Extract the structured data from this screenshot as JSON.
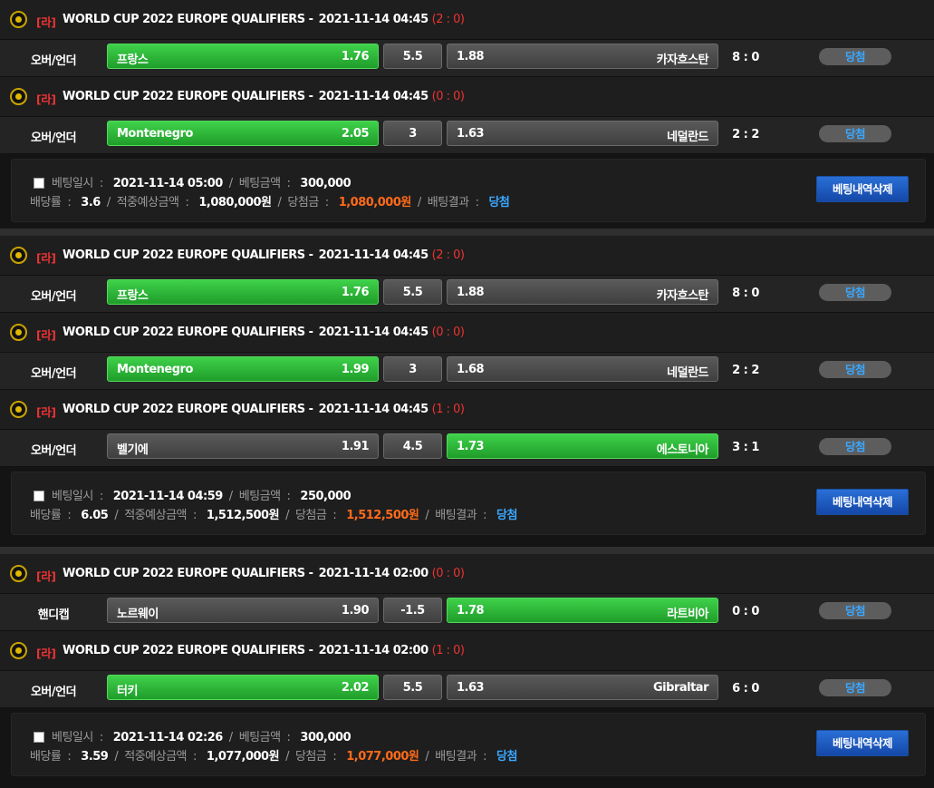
{
  "slips": [
    {
      "matches": [
        {
          "tag": "[라]",
          "league": "WORLD CUP 2022 EUROPE QUALIFIERS -",
          "date": "2021-11-14 04:45",
          "half_score": "(2 : 0)",
          "type": "오버/언더",
          "home": "프랑스",
          "home_odds": "1.76",
          "mid": "5.5",
          "away_odds": "1.88",
          "away": "카자흐스탄",
          "final_score": "8 : 0",
          "result": "당첨",
          "win": "home"
        },
        {
          "tag": "[라]",
          "league": "WORLD CUP 2022 EUROPE QUALIFIERS -",
          "date": "2021-11-14 04:45",
          "half_score": "(0 : 0)",
          "type": "오버/언더",
          "home": "Montenegro",
          "home_odds": "2.05",
          "mid": "3",
          "away_odds": "1.63",
          "away": "네덜란드",
          "final_score": "2 : 2",
          "result": "당첨",
          "win": "home"
        }
      ],
      "summary": {
        "bet_time_label": "베팅일시",
        "bet_time": "2021-11-14 05:00",
        "bet_amount_label": "베팅금액",
        "bet_amount": "300,000",
        "odds_label": "배당률",
        "odds": "3.6",
        "expected_label": "적중예상금액",
        "expected": "1,080,000원",
        "win_amount_label": "당첨금",
        "win_amount": "1,080,000원",
        "result_label": "배팅결과",
        "result": "당첨",
        "delete_label": "베팅내역삭제"
      }
    },
    {
      "matches": [
        {
          "tag": "[라]",
          "league": "WORLD CUP 2022 EUROPE QUALIFIERS -",
          "date": "2021-11-14 04:45",
          "half_score": "(2 : 0)",
          "type": "오버/언더",
          "home": "프랑스",
          "home_odds": "1.76",
          "mid": "5.5",
          "away_odds": "1.88",
          "away": "카자흐스탄",
          "final_score": "8 : 0",
          "result": "당첨",
          "win": "home"
        },
        {
          "tag": "[라]",
          "league": "WORLD CUP 2022 EUROPE QUALIFIERS -",
          "date": "2021-11-14 04:45",
          "half_score": "(0 : 0)",
          "type": "오버/언더",
          "home": "Montenegro",
          "home_odds": "1.99",
          "mid": "3",
          "away_odds": "1.68",
          "away": "네덜란드",
          "final_score": "2 : 2",
          "result": "당첨",
          "win": "home"
        },
        {
          "tag": "[라]",
          "league": "WORLD CUP 2022 EUROPE QUALIFIERS -",
          "date": "2021-11-14 04:45",
          "half_score": "(1 : 0)",
          "type": "오버/언더",
          "home": "벨기에",
          "home_odds": "1.91",
          "mid": "4.5",
          "away_odds": "1.73",
          "away": "에스토니아",
          "final_score": "3 : 1",
          "result": "당첨",
          "win": "away"
        }
      ],
      "summary": {
        "bet_time_label": "베팅일시",
        "bet_time": "2021-11-14 04:59",
        "bet_amount_label": "베팅금액",
        "bet_amount": "250,000",
        "odds_label": "배당률",
        "odds": "6.05",
        "expected_label": "적중예상금액",
        "expected": "1,512,500원",
        "win_amount_label": "당첨금",
        "win_amount": "1,512,500원",
        "result_label": "배팅결과",
        "result": "당첨",
        "delete_label": "베팅내역삭제"
      }
    },
    {
      "matches": [
        {
          "tag": "[라]",
          "league": "WORLD CUP 2022 EUROPE QUALIFIERS -",
          "date": "2021-11-14 02:00",
          "half_score": "(0 : 0)",
          "type": "핸디캡",
          "home": "노르웨이",
          "home_odds": "1.90",
          "mid": "-1.5",
          "away_odds": "1.78",
          "away": "라트비아",
          "final_score": "0 : 0",
          "result": "당첨",
          "win": "away"
        },
        {
          "tag": "[라]",
          "league": "WORLD CUP 2022 EUROPE QUALIFIERS -",
          "date": "2021-11-14 02:00",
          "half_score": "(1 : 0)",
          "type": "오버/언더",
          "home": "터키",
          "home_odds": "2.02",
          "mid": "5.5",
          "away_odds": "1.63",
          "away": "Gibraltar",
          "final_score": "6 : 0",
          "result": "당첨",
          "win": "home"
        }
      ],
      "summary": {
        "bet_time_label": "베팅일시",
        "bet_time": "2021-11-14 02:26",
        "bet_amount_label": "베팅금액",
        "bet_amount": "300,000",
        "odds_label": "배당률",
        "odds": "3.59",
        "expected_label": "적중예상금액",
        "expected": "1,077,000원",
        "win_amount_label": "당첨금",
        "win_amount": "1,077,000원",
        "result_label": "배팅결과",
        "result": "당첨",
        "delete_label": "베팅내역삭제"
      }
    }
  ]
}
